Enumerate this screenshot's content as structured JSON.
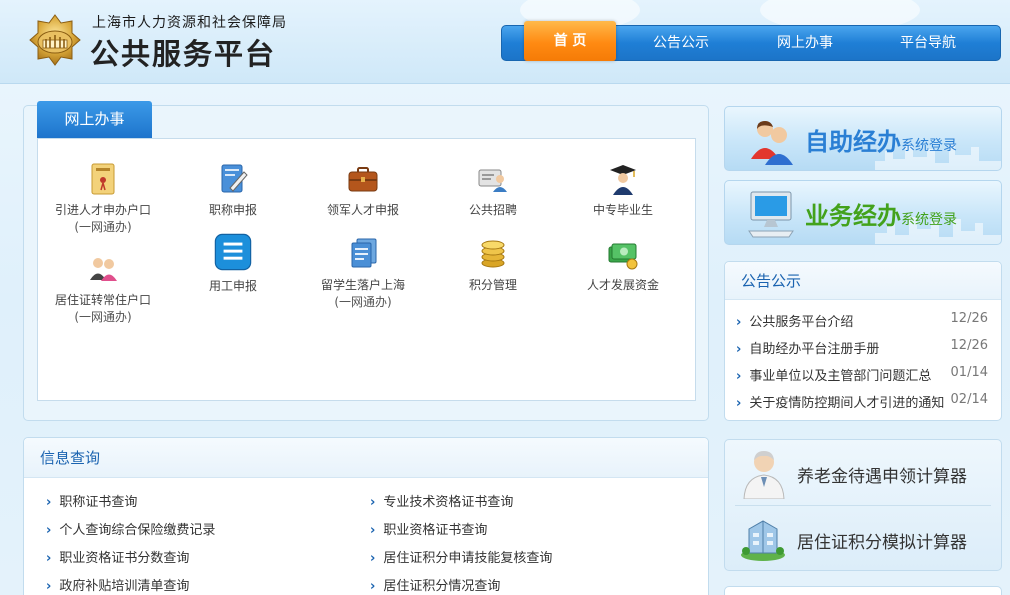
{
  "header": {
    "org_name": "上海市人力资源和社会保障局",
    "platform_name": "公共服务平台",
    "nav": [
      {
        "label": "首 页",
        "active": true
      },
      {
        "label": "公告公示",
        "active": false
      },
      {
        "label": "网上办事",
        "active": false
      },
      {
        "label": "平台导航",
        "active": false
      }
    ]
  },
  "online_service": {
    "tab_label": "网上办事",
    "items": [
      {
        "label": "引进人才申办户口",
        "sub": "(一网通办)",
        "icon": "folder-document-icon"
      },
      {
        "label": "职称申报",
        "sub": "",
        "icon": "certificate-pen-icon"
      },
      {
        "label": "领军人才申报",
        "sub": "",
        "icon": "briefcase-icon"
      },
      {
        "label": "公共招聘",
        "sub": "",
        "icon": "recruitment-card-icon"
      },
      {
        "label": "中专毕业生",
        "sub": "",
        "icon": "graduate-icon"
      },
      {
        "label": "居住证转常住户口",
        "sub": "(一网通办)",
        "icon": "people-couple-icon"
      },
      {
        "label": "用工申报",
        "sub": "",
        "icon": "list-document-icon"
      },
      {
        "label": "留学生落户上海",
        "sub": "(一网通办)",
        "icon": "stacked-documents-icon"
      },
      {
        "label": "积分管理",
        "sub": "",
        "icon": "coin-stack-icon"
      },
      {
        "label": "人才发展资金",
        "sub": "",
        "icon": "money-bundle-icon"
      }
    ]
  },
  "login": {
    "self_service": {
      "big": "自助经办",
      "small": "系统登录"
    },
    "business": {
      "big": "业务经办",
      "small": "系统登录"
    }
  },
  "notice": {
    "title": "公告公示",
    "items": [
      {
        "title": "公共服务平台介绍",
        "date": "12/26"
      },
      {
        "title": "自助经办平台注册手册",
        "date": "12/26"
      },
      {
        "title": "事业单位以及主管部门问题汇总",
        "date": "01/14"
      },
      {
        "title": "关于疫情防控期间人才引进的通知",
        "date": "02/14"
      }
    ]
  },
  "info_query": {
    "title": "信息查询",
    "left": [
      "职称证书查询",
      "个人查询综合保险缴费记录",
      "职业资格证书分数查询",
      "政府补贴培训清单查询"
    ],
    "right": [
      "专业技术资格证书查询",
      "职业资格证书查询",
      "居住证积分申请技能复核查询",
      "居住证积分情况查询"
    ]
  },
  "calculators": {
    "pension": "养老金待遇申领计算器",
    "residence": "居住证积分模拟计算器"
  },
  "colors": {
    "nav_blue": "#1f7fd6",
    "nav_active_orange": "#ff8a12",
    "link_blue": "#1a63b0",
    "self_service_text": "#2a7fd4",
    "business_text": "#43a21c"
  }
}
